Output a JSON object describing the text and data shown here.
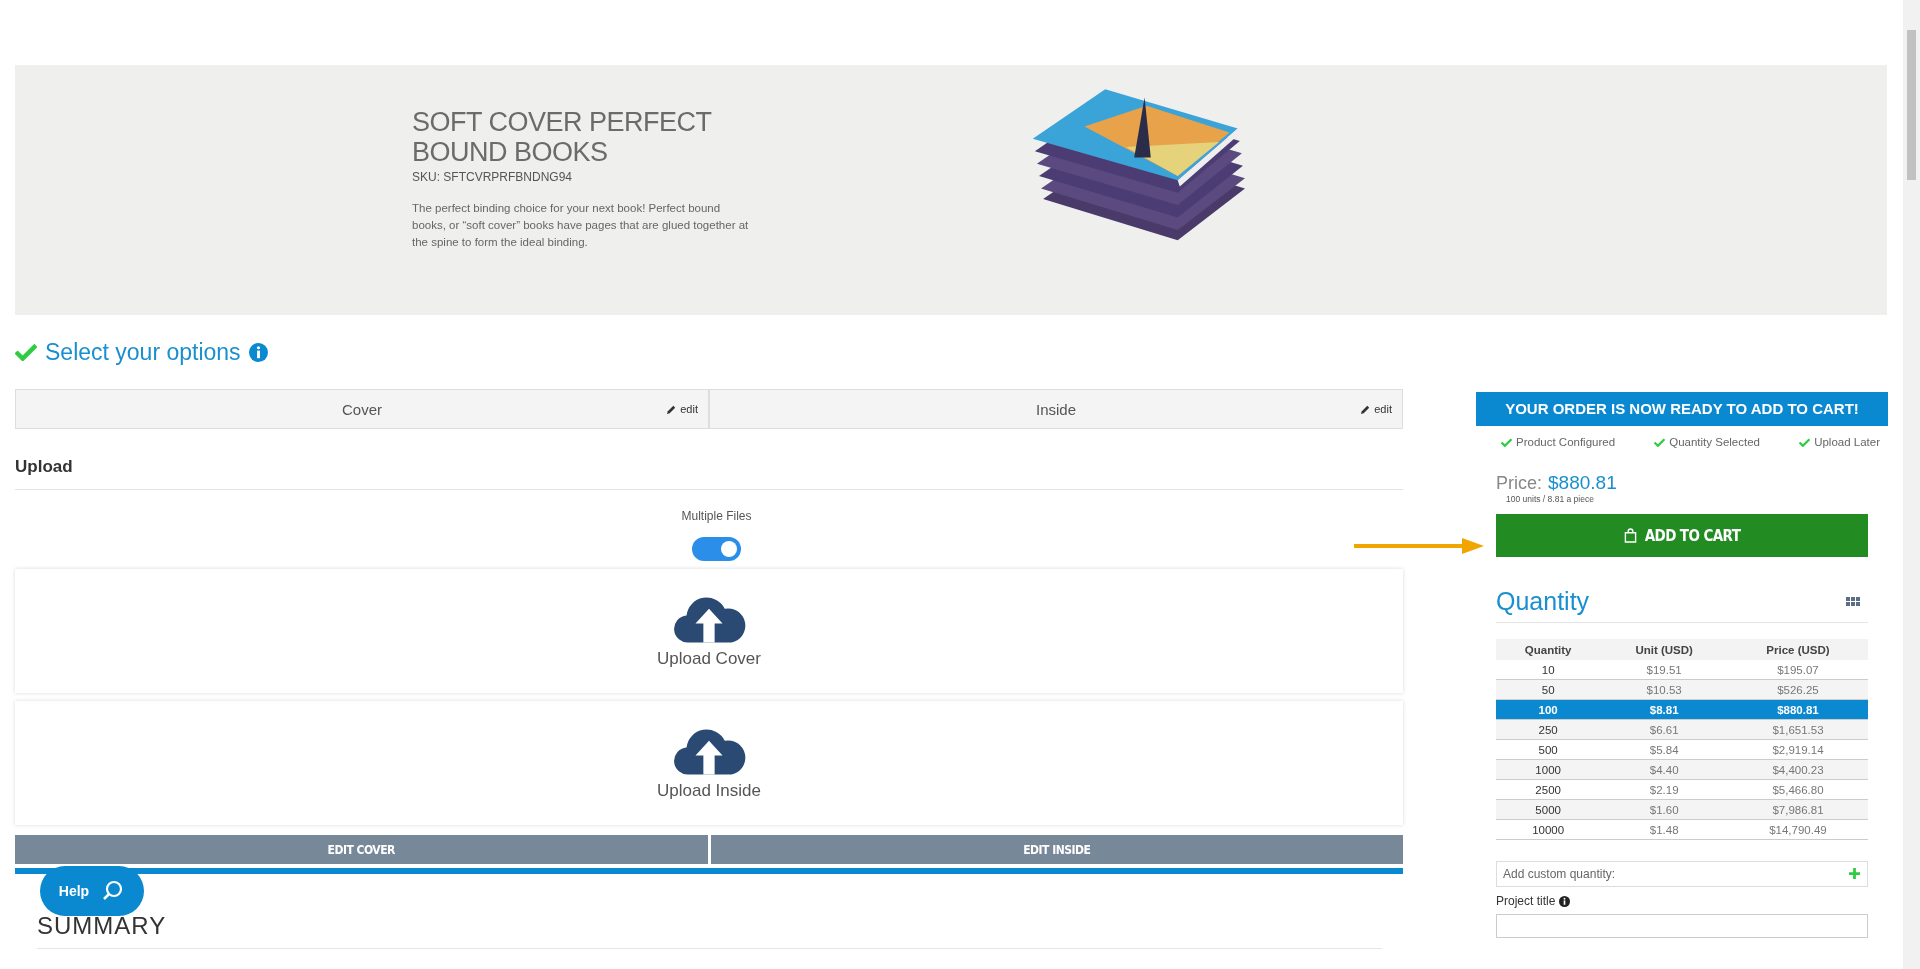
{
  "product": {
    "title": "SOFT COVER PERFECT BOUND BOOKS",
    "sku": "SKU: SFTCVRPRFBNDNG94",
    "description": "The perfect binding choice for your next book! Perfect bound books, or “soft cover” books have pages that are glued together at the spine to form the ideal binding."
  },
  "options": {
    "heading": "Select your options",
    "complete": true,
    "tabs": [
      {
        "label": "Cover",
        "edit": "edit"
      },
      {
        "label": "Inside",
        "edit": "edit"
      }
    ]
  },
  "upload": {
    "heading": "Upload",
    "multiple_files_label": "Multiple Files",
    "multiple_files_on": true,
    "zones": [
      {
        "label": "Upload Cover"
      },
      {
        "label": "Upload Inside"
      }
    ],
    "edit_buttons": [
      "EDIT COVER",
      "EDIT INSIDE"
    ]
  },
  "summary": {
    "heading": "SUMMARY"
  },
  "help_button": {
    "label": "Help"
  },
  "order": {
    "banner": "YOUR ORDER IS NOW READY TO ADD TO CART!",
    "steps": [
      {
        "label": "Product Configured",
        "done": true
      },
      {
        "label": "Quantity Selected",
        "done": true
      },
      {
        "label": "Upload Later",
        "done": true
      }
    ],
    "price_label": "Price:",
    "price": "$880.81",
    "price_note": "100 units / 8.81 a piece",
    "add_to_cart": "ADD TO CART",
    "quantity_heading": "Quantity",
    "table": {
      "columns": [
        "Quantity",
        "Unit (USD)",
        "Price (USD)"
      ],
      "rows": [
        {
          "cells": [
            "10",
            "$19.51",
            "$195.07"
          ],
          "selected": false
        },
        {
          "cells": [
            "50",
            "$10.53",
            "$526.25"
          ],
          "selected": false
        },
        {
          "cells": [
            "100",
            "$8.81",
            "$880.81"
          ],
          "selected": true
        },
        {
          "cells": [
            "250",
            "$6.61",
            "$1,651.53"
          ],
          "selected": false
        },
        {
          "cells": [
            "500",
            "$5.84",
            "$2,919.14"
          ],
          "selected": false
        },
        {
          "cells": [
            "1000",
            "$4.40",
            "$4,400.23"
          ],
          "selected": false
        },
        {
          "cells": [
            "2500",
            "$2.19",
            "$5,466.80"
          ],
          "selected": false
        },
        {
          "cells": [
            "5000",
            "$1.60",
            "$7,986.81"
          ],
          "selected": false
        },
        {
          "cells": [
            "10000",
            "$1.48",
            "$14,790.49"
          ],
          "selected": false
        }
      ]
    },
    "custom_quantity_placeholder": "Add custom quantity:",
    "project_title_label": "Project title"
  }
}
